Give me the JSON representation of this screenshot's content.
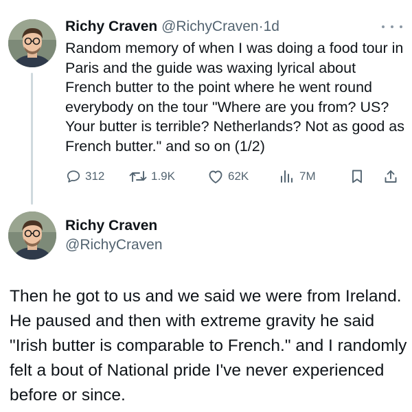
{
  "tweet1": {
    "author_name": "Richy Craven",
    "author_handle": "@RichyCraven",
    "separator": "·",
    "time": "1d",
    "text": "Random memory of when I was doing a food tour in Paris and the guide was waxing lyrical about French butter to the point where he went round everybody on the tour \"Where are you from? US? Your butter is terrible? Netherlands? Not as good as French butter.\" and so on (1/2)",
    "actions": {
      "replies": "312",
      "reposts": "1.9K",
      "likes": "62K",
      "views": "7M"
    }
  },
  "tweet2": {
    "author_name": "Richy Craven",
    "author_handle": "@RichyCraven",
    "text": "Then he got to us and we said we were from Ireland. He paused and then with extreme gravity he said \"Irish butter is comparable to French.\" and I randomly felt a bout of National pride I've never experienced before or since."
  },
  "icons": {
    "more": "more-horizontal-icon",
    "reply": "reply-icon",
    "repost": "repost-icon",
    "like": "heart-icon",
    "views": "views-chart-icon",
    "bookmark": "bookmark-icon",
    "share": "share-icon"
  },
  "colors": {
    "text_primary": "#0f1419",
    "text_secondary": "#536471",
    "thread_line": "#cfd9de",
    "background": "#ffffff"
  }
}
